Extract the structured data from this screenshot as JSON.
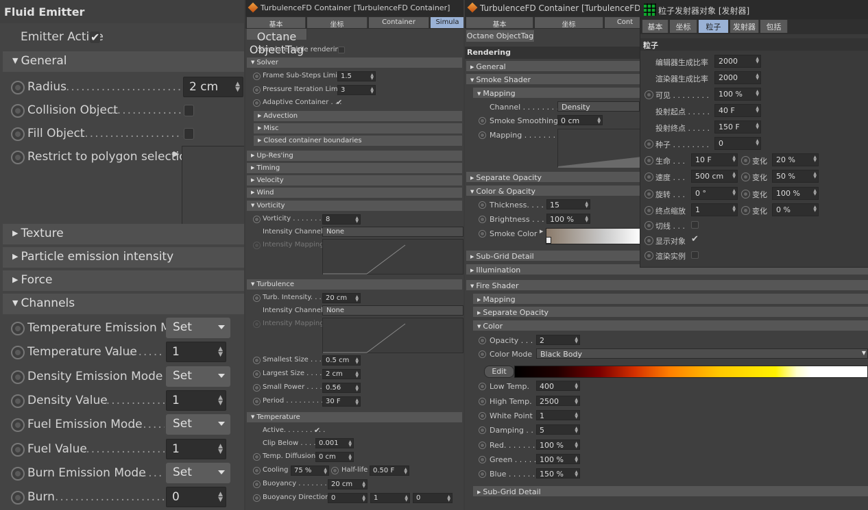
{
  "p1": {
    "title": "Fluid Emitter",
    "emitter_active": "Emitter Active",
    "general": "General",
    "radius_label": "Radius",
    "radius_dots": "................................",
    "radius_value": "2 cm",
    "collision_label": "Collision Object",
    "collision_dots": "........................",
    "fill_label": "Fill Object",
    "fill_dots": "......................................",
    "restrict_label": "Restrict to polygon selections",
    "texture": "Texture",
    "particle": "Particle emission intensity",
    "force": "Force",
    "channels": "Channels",
    "temp_mode_label": "Temperature Emission Mode",
    "temp_mode_value": "Set",
    "temp_value_label": "Temperature Value",
    "temp_value_dots": ".............",
    "temp_value": "1",
    "density_mode_label": "Density Emission Mode",
    "density_mode_dots": "..",
    "density_mode_value": "Set",
    "density_value_label": "Density Value",
    "density_value_dots": "......................",
    "density_value": "1",
    "fuel_mode_label": "Fuel Emission Mode",
    "fuel_mode_dots": ".........",
    "fuel_mode_value": "Set",
    "fuel_value_label": "Fuel Value",
    "fuel_value_dots": "............................",
    "fuel_value": "1",
    "burn_mode_label": "Burn Emission Mode",
    "burn_mode_dots": "........",
    "burn_mode_value": "Set",
    "burn_label": "Burn",
    "burn_dots": "....................................................",
    "burn_value": "0"
  },
  "p2": {
    "title": "TurbulenceFD Container [TurbulenceFD Container]",
    "tabs": [
      "基本",
      "坐标",
      "Container",
      "Simula"
    ],
    "octane_tag": "Octane ObjectTag",
    "simulate_while_rendering": "Simulate while rendering",
    "solver": "Solver",
    "frame_substeps": "Frame Sub-Steps Limit",
    "frame_substeps_value": "1.5",
    "pressure": "Pressure Iteration Limit",
    "pressure_value": "3",
    "adaptive": "Adaptive Container . . .",
    "advection": "Advection",
    "misc": "Misc",
    "closed": "Closed container boundaries",
    "upres": "Up-Res'ing",
    "timing": "Timing",
    "velocity": "Velocity",
    "wind": "Wind",
    "vorticity": "Vorticity",
    "vorticity_label": "Vorticity . . . . . . . . . .",
    "vorticity_value": "8",
    "intensity_channel": "Intensity Channel",
    "intensity_channel_value": "None",
    "intensity_mapping": "Intensity Mapping",
    "turbulence": "Turbulence",
    "turb_intensity": "Turb. Intensity. . . .",
    "turb_intensity_value": "20 cm",
    "intensity_channel2": "Intensity Channel",
    "intensity_channel2_value": "None",
    "intensity_mapping2": "Intensity Mapping",
    "smallest_size": "Smallest Size . . . . .",
    "smallest_size_value": "0.5 cm",
    "largest_size": "Largest Size . . . . . .",
    "largest_size_value": "2 cm",
    "small_power": "Small Power . . . . . .",
    "small_power_value": "0.56",
    "period": "Period . . . . . . . . . . .",
    "period_value": "30 F",
    "temperature": "Temperature",
    "active": "Active. . . . . . . . . .",
    "clip_below": "Clip Below . . . . .",
    "clip_below_value": "0.001",
    "temp_diffusion": "Temp. Diffusion",
    "temp_diffusion_value": "0 cm",
    "cooling": "Cooling",
    "cooling_value": "75 %",
    "half_life": "Half-life",
    "half_life_value": "0.50 F",
    "buoyancy": "Buoyancy . . . . . . . . . .",
    "buoyancy_value": "20 cm",
    "buoyancy_dir": "Buoyancy Direction",
    "buoyancy_dir_x": "0",
    "buoyancy_dir_y": "1",
    "buoyancy_dir_z": "0"
  },
  "p3": {
    "title": "TurbulenceFD Container [TurbulenceFD Con",
    "tabs": [
      "基本",
      "坐标",
      "Cont"
    ],
    "octane_tag": "Octane ObjectTag",
    "rendering": "Rendering",
    "general": "General",
    "smoke_shader": "Smoke Shader",
    "mapping": "Mapping",
    "channel": "Channel . . . . . . . . .",
    "channel_value": "Density",
    "smoke_smoothing": "Smoke Smoothing",
    "smoke_smoothing_value": "0 cm",
    "mapping_label": "Mapping . . . . . . . . .",
    "separate_opacity": "Separate Opacity",
    "color_opacity": "Color & Opacity",
    "thickness": "Thickness. . . . .",
    "thickness_value": "15",
    "brightness": "Brightness . . . .",
    "brightness_value": "100 %",
    "smoke_color": "Smoke Color",
    "subgrid": "Sub-Grid Detail",
    "illumination": "Illumination",
    "fire_shader": "Fire Shader",
    "fire_mapping": "Mapping",
    "fire_separate_opacity": "Separate Opacity",
    "fire_color": "Color",
    "opacity": "Opacity . . .",
    "opacity_value": "2",
    "color_mode": "Color Mode",
    "color_mode_value": "Black Body",
    "edit": "Edit",
    "low_temp": "Low Temp.",
    "low_temp_value": "400",
    "high_temp": "High Temp.",
    "high_temp_value": "2500",
    "white_point": "White Point",
    "white_point_value": "1",
    "damping": "Damping . .",
    "damping_value": "5",
    "red": "Red. . . . . . .",
    "red_value": "100 %",
    "green": "Green . . . . .",
    "green_value": "100 %",
    "blue": "Blue . . . . . .",
    "blue_value": "150 %",
    "fire_subgrid": "Sub-Grid Detail"
  },
  "p4": {
    "title": "粒子发射器对象 [发射器]",
    "tabs": [
      "基本",
      "坐标",
      "粒子",
      "发射器",
      "包括"
    ],
    "section": "粒子",
    "editor_rate": "编辑器生成比率",
    "editor_rate_value": "2000",
    "render_rate": "渲染器生成比率",
    "render_rate_value": "2000",
    "visible": "可见 . . . . . . . .",
    "visible_value": "100 %",
    "start": "投射起点 . . . . .",
    "start_value": "40 F",
    "end": "投射终点 . . . . .",
    "end_value": "150 F",
    "seed": "种子 . . . . . . . .",
    "seed_value": "0",
    "life": "生命 . . .",
    "life_value": "10 F",
    "life_var": "变化",
    "life_var_value": "20 %",
    "speed": "速度 . . .",
    "speed_value": "500 cm",
    "speed_var": "变化",
    "speed_var_value": "50 %",
    "rotation": "旋转 . . .",
    "rotation_value": "0 °",
    "rotation_var": "变化",
    "rotation_var_value": "100 %",
    "end_scale": "终点缩放",
    "end_scale_value": "1",
    "end_scale_var": "变化",
    "end_scale_var_value": "0 %",
    "tangential": "切线 . . .",
    "show_objects": "显示对象",
    "render_instances": "渲染实例"
  },
  "colors": {
    "selected_tab": "#9ab2d6",
    "checkmark": "#e6e6e6"
  }
}
